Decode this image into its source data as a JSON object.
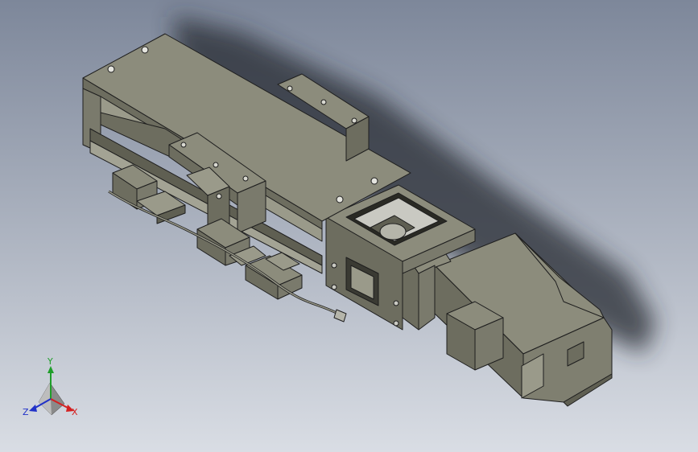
{
  "viewport": {
    "background_top": "#7d879a",
    "background_bottom": "#d9dde4"
  },
  "model": {
    "body_color": "#8c8c7c",
    "body_dark": "#5f5f52",
    "body_light": "#a3a394",
    "edge_color": "#1e1e1e",
    "shadow_color": "#262a33",
    "metal_color": "#c9c9c2",
    "icon": "linear-actuator-assembly-icon"
  },
  "triad": {
    "x_label": "X",
    "y_label": "Y",
    "z_label": "Z",
    "x_color": "#d42020",
    "y_color": "#1f9e2a",
    "z_color": "#2031c8"
  }
}
